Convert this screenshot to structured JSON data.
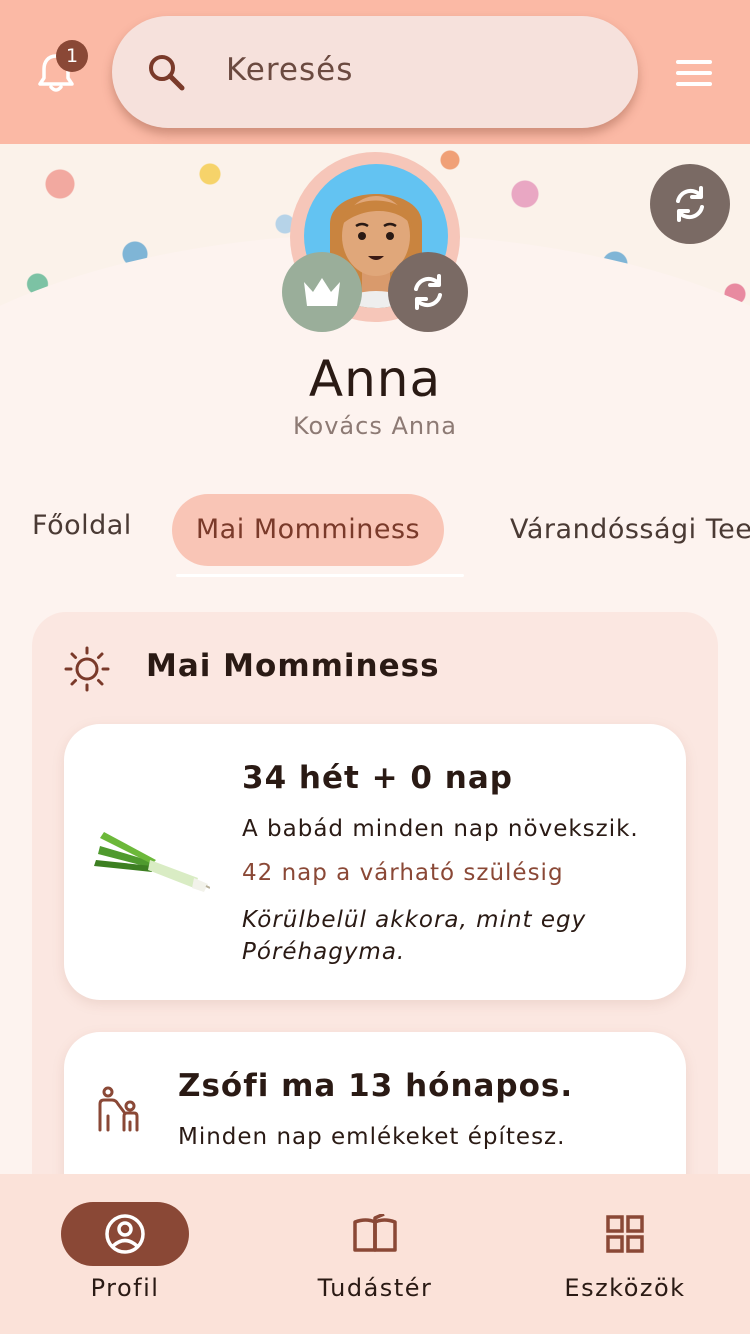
{
  "header": {
    "notification_count": "1",
    "search_placeholder": "Keresés"
  },
  "profile": {
    "name": "Anna",
    "full_name": "Kovács Anna"
  },
  "tabs": [
    {
      "label": "Főoldal"
    },
    {
      "label": "Mai Momminess"
    },
    {
      "label": "Várandóssági Tee"
    }
  ],
  "section": {
    "title": "Mai Momminess"
  },
  "week_card": {
    "title": "34 hét + 0 nap",
    "subtitle": "A babád minden nap növekszik.",
    "days_left": "42 nap a várható szülésig",
    "size_note": "Körülbelül akkora, mint egy Póréhagyma."
  },
  "child_card": {
    "title": "Zsófi ma 13 hónapos.",
    "subtitle": "Minden nap emlékeket építesz."
  },
  "bottom_nav": [
    {
      "label": "Profil"
    },
    {
      "label": "Tudástér"
    },
    {
      "label": "Eszközök"
    }
  ],
  "colors": {
    "header": "#fbb9a5",
    "accent": "#8a4836",
    "tab_active": "#f9c5b6",
    "crown_button": "#9aae9a",
    "refresh_button": "#7a6a64"
  },
  "icons": [
    "bell-icon",
    "search-icon",
    "menu-icon",
    "refresh-icon",
    "crown-icon",
    "sun-icon",
    "leek-image",
    "parent-child-icon",
    "profile-icon",
    "book-icon",
    "grid-icon"
  ]
}
